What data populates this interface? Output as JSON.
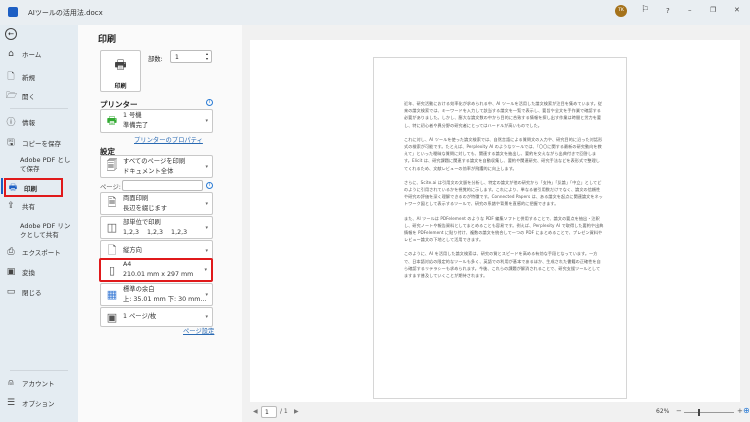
{
  "titlebar": {
    "filename": "AIツールの活用法.docx",
    "avatar": "TK",
    "help": "?",
    "minimize": "–",
    "restore": "❐",
    "close": "✕"
  },
  "sidebar": {
    "items": [
      {
        "label": "ホーム",
        "icon": "⌂"
      },
      {
        "label": "新規",
        "icon": "🗋"
      },
      {
        "label": "開く",
        "icon": "🗁"
      },
      {
        "label": "情報",
        "icon": "ⓘ"
      },
      {
        "label": "コピーを保存",
        "icon": "🖫"
      },
      {
        "label": "Adobe PDF として保存",
        "icon": ""
      },
      {
        "label": "印刷",
        "icon": "🖶"
      },
      {
        "label": "共有",
        "icon": "⇪"
      },
      {
        "label": "Adobe PDF リンクとして共有",
        "icon": ""
      },
      {
        "label": "エクスポート",
        "icon": "⎙"
      },
      {
        "label": "変換",
        "icon": "▣"
      },
      {
        "label": "閉じる",
        "icon": "▭"
      },
      {
        "label": "アカウント",
        "icon": "⍝"
      },
      {
        "label": "オプション",
        "icon": "☰"
      }
    ]
  },
  "print": {
    "title": "印刷",
    "print_button": "印刷",
    "copies_label": "部数:",
    "copies_value": "1",
    "printer_heading": "プリンター",
    "printer_name": "1 号機",
    "printer_status": "準備完了",
    "printer_properties": "プリンターのプロパティ",
    "settings_heading": "設定",
    "pages_label": "ページ:",
    "pages_value": "",
    "settings": [
      {
        "line1": "すべてのページを印刷",
        "line2": "ドキュメント全体"
      },
      {
        "line1": "両面印刷",
        "line2": "長辺を綴じます"
      },
      {
        "line1": "部単位で印刷",
        "line2": "1,2,3    1,2,3    1,2,3"
      },
      {
        "line1": "縦方向",
        "line2": ""
      },
      {
        "line1": "A4",
        "line2": "210.01 mm x 297 mm"
      },
      {
        "line1": "標準の余白",
        "line2": "上: 35.01 mm 下: 30 mm…"
      },
      {
        "line1": "1 ページ/枚",
        "line2": ""
      }
    ],
    "page_setup": "ページ設定"
  },
  "document": {
    "paragraphs": [
      "近年、研究活動における効率化が求められる中、AI ツールを活用した論文検索が注目を集めています。従来の論文検索では、キーワードを入力して該当する論文を一覧で表示し、要旨や全文を手作業で確認する必要がありました。しかし、膨大な論文数の中から目的に合致する情報を探し出す作業は時間と労力を要し、特に初心者や異分野の研究者にとってはハードルが高いものでした。",
      "これに対し、AI ツールを使った論文検索では、自然言語による質問文の入力や、研究目的に沿った対話形式の検索が可能です。たとえば、Perplexity AI のようなツールでは、「〇〇に関する最新の研究動向を教えて」といった曖昧な質問に対しても、関連する論文を抽出し、要約を交えながら出典付きで回答します。Elicit は、研究課題に関連する論文を自動収集し、要約や関連研究、研究手法などを表形式で整理してくれるため、文献レビューの効率が飛躍的に向上します。",
      "さらに、Scite.ai は引用文の文脈を分析し、特定の論文が他の研究から「支持」「反論」「中立」としてどのように引用されているかを視覚的に示します。これにより、単なる被引用数だけでなく、論文の信頼性や研究の評価を深く理解できるのが特徴です。Connected Papers は、ある論文を起点に関連論文をネットワーク図として表示するツールで、研究の系譜や背景を直感的に把握できます。",
      "また、AI ツールは PDFelement のような PDF 編集ソフトと併用することで、論文の要点を抽出・注釈し、研究ノートや報告資料としてまとめることも容易です。例えば、Perplexity AI で取得した要約や出典情報を PDFelement に貼り付け、複数の論文を統合して一つの PDF にまとめることで、プレゼン資料やレビュー論文の下地として活用できます。",
      "このように、AI を活用した論文検索は、研究の質とスピードを高める有効な手段となっています。一方で、日本語対応の限定的なツールも多く、英語での利用が基本であるほか、生成された書籍の正確性を自ら確認するリテラシーも求められます。今後、これらの課題が解消されることで、研究支援ツールとしてますます普及していくことが期待されます。"
    ]
  },
  "pager": {
    "current": "1",
    "total": "/ 1"
  },
  "zoom": {
    "label": "62%",
    "value": 62
  },
  "colors": {
    "highlight": "#e0191b",
    "accent": "#2a6ab3",
    "avatar": "#a5721b"
  }
}
